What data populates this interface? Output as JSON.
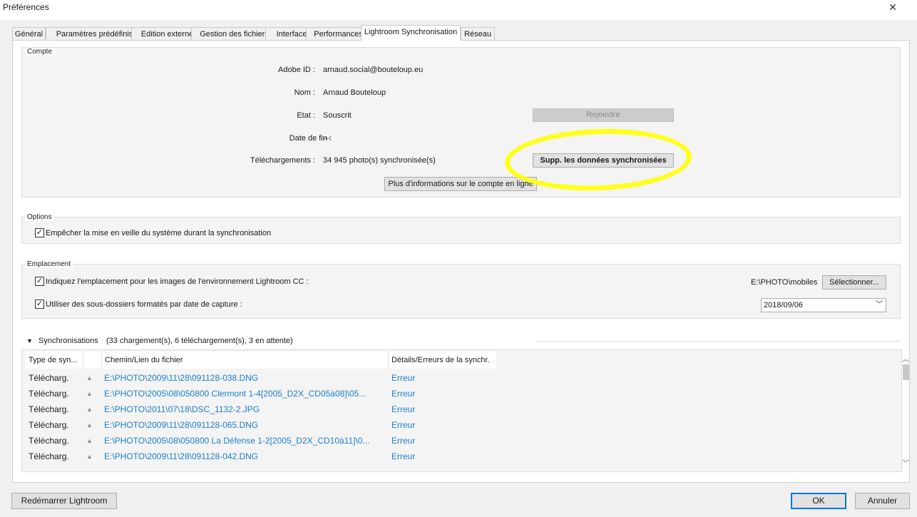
{
  "window": {
    "title": "Préférences"
  },
  "tabs": [
    {
      "label": "Général"
    },
    {
      "label": "Paramètres prédéfinis"
    },
    {
      "label": "Edition externe"
    },
    {
      "label": "Gestion des fichiers"
    },
    {
      "label": "Interface"
    },
    {
      "label": "Performances"
    },
    {
      "label": "Lightroom Synchronisation"
    },
    {
      "label": "Réseau"
    }
  ],
  "account": {
    "legend": "Compte",
    "adobe_id_label": "Adobe ID :",
    "adobe_id_value": "arnaud.social@bouteloup.eu",
    "name_label": "Nom :",
    "name_value": "Arnaud Bouteloup",
    "state_label": "Etat :",
    "state_value": "Souscrit",
    "end_label": "Date de fin :",
    "end_value": "---",
    "downloads_label": "Téléchargements :",
    "downloads_value": "34 945 photo(s) synchronisée(s)",
    "join_button": "Rejoindre",
    "delete_button": "Supp. les données synchronisées",
    "more_info_button": "Plus d'informations sur le compte en ligne"
  },
  "options": {
    "legend": "Options",
    "prevent_sleep_label": "Empêcher la mise en veille du système durant la synchronisation",
    "prevent_sleep_checked": true
  },
  "location": {
    "legend": "Emplacement",
    "specify_label": "Indiquez l'emplacement pour les images de l'environnement Lightroom CC :",
    "specify_checked": true,
    "path_value": "E:\\PHOTO\\mobiles",
    "select_button": "Sélectionner...",
    "subfolders_label": "Utiliser des sous-dossiers formatés par date de capture :",
    "subfolders_checked": true,
    "date_format": "2018/09/06"
  },
  "sync": {
    "title": "Synchronisations",
    "summary": "(33 chargement(s), 6 téléchargement(s), 3 en attente)",
    "columns": [
      {
        "label": "Type de syn..."
      },
      {
        "label": ""
      },
      {
        "label": "Chemin/Lien du fichier"
      },
      {
        "label": "Détails/Erreurs de la synchr."
      }
    ],
    "rows": [
      {
        "type": "Télécharg.",
        "path": "E:\\PHOTO\\2009\\11\\28\\091128-038.DNG",
        "status": "Erreur"
      },
      {
        "type": "Télécharg.",
        "path": "E:\\PHOTO\\2005\\08\\050800 Clermont 1-4[2005_D2X_CD05à08]\\05...",
        "status": "Erreur"
      },
      {
        "type": "Télécharg.",
        "path": "E:\\PHOTO\\2011\\07\\18\\DSC_1132-2.JPG",
        "status": "Erreur"
      },
      {
        "type": "Télécharg.",
        "path": "E:\\PHOTO\\2009\\11\\28\\091128-065.DNG",
        "status": "Erreur"
      },
      {
        "type": "Télécharg.",
        "path": "E:\\PHOTO\\2005\\08\\050800 La Défense 1-2[2005_D2X_CD10à11]\\0...",
        "status": "Erreur"
      },
      {
        "type": "Télécharg.",
        "path": "E:\\PHOTO\\2009\\11\\28\\091128-042.DNG",
        "status": "Erreur"
      }
    ]
  },
  "footer": {
    "restart_button": "Redémarrer Lightroom",
    "ok_button": "OK",
    "cancel_button": "Annuler"
  },
  "colors": {
    "highlight": "#ffff1c",
    "link": "#1a7fd1",
    "default_button_border": "#0078d7"
  }
}
